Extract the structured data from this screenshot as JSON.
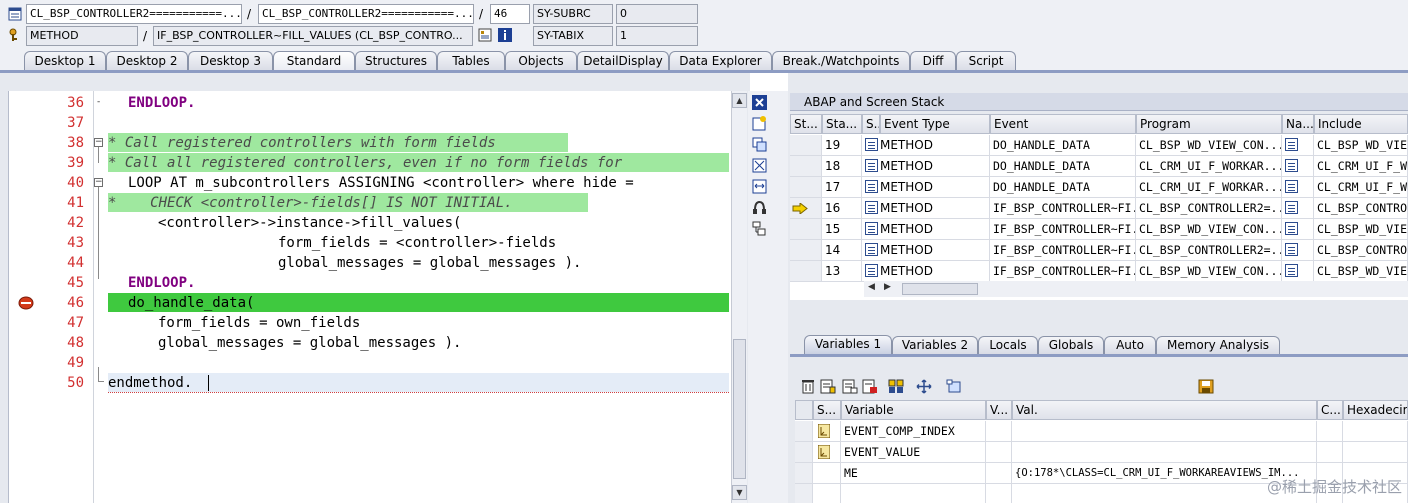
{
  "top_fields": {
    "row1": {
      "field1": "CL_BSP_CONTROLLER2===========...",
      "sep1": "/",
      "field2": "CL_BSP_CONTROLLER2===========...",
      "sep2": "/",
      "line": "46",
      "sysvar_name": "SY-SUBRC",
      "sysvar_value": "0"
    },
    "row2": {
      "field1": "METHOD",
      "sep1": "/",
      "field2": "IF_BSP_CONTROLLER~FILL_VALUES (CL_BSP_CONTRO...",
      "sysvar_name": "SY-TABIX",
      "sysvar_value": "1"
    }
  },
  "tabs": [
    "Desktop 1",
    "Desktop 2",
    "Desktop 3",
    "Standard",
    "Structures",
    "Tables",
    "Objects",
    "DetailDisplay",
    "Data Explorer",
    "Break./Watchpoints",
    "Diff",
    "Script"
  ],
  "active_tab": "Standard",
  "editor": {
    "lines": [
      {
        "no": "36",
        "text": "ENDLOOP."
      },
      {
        "no": "37",
        "text": ""
      },
      {
        "no": "38",
        "text": "* Call registered controllers with form fields"
      },
      {
        "no": "39",
        "text": "* Call all registered controllers, even if no form fields for"
      },
      {
        "no": "40",
        "text": "LOOP AT m_subcontrollers ASSIGNING <controller> where hide ="
      },
      {
        "no": "41",
        "text": "*    CHECK <controller>-fields[] IS NOT INITIAL."
      },
      {
        "no": "42",
        "text": "<controller>->instance->fill_values("
      },
      {
        "no": "43",
        "text": "form_fields = <controller>-fields"
      },
      {
        "no": "44",
        "text": "global_messages = global_messages )."
      },
      {
        "no": "45",
        "text": "ENDLOOP."
      },
      {
        "no": "46",
        "text": "do_handle_data("
      },
      {
        "no": "47",
        "text": "form_fields = own_fields"
      },
      {
        "no": "48",
        "text": "global_messages = global_messages )."
      },
      {
        "no": "49",
        "text": ""
      },
      {
        "no": "50",
        "text": "endmethod."
      }
    ]
  },
  "stack": {
    "title": "ABAP and Screen Stack",
    "headers": [
      "St...",
      "Sta...",
      "S...",
      "Event Type",
      "Event",
      "Program",
      "Na...",
      "Include"
    ],
    "rows": [
      {
        "level": "19",
        "type": "METHOD",
        "event": "DO_HANDLE_DATA",
        "program": "CL_BSP_WD_VIEW_CON...",
        "include": "CL_BSP_WD_VIE",
        "current": false
      },
      {
        "level": "18",
        "type": "METHOD",
        "event": "DO_HANDLE_DATA",
        "program": "CL_CRM_UI_F_WORKAR...",
        "include": "CL_CRM_UI_F_W",
        "current": false
      },
      {
        "level": "17",
        "type": "METHOD",
        "event": "DO_HANDLE_DATA",
        "program": "CL_CRM_UI_F_WORKAR...",
        "include": "CL_CRM_UI_F_W",
        "current": false
      },
      {
        "level": "16",
        "type": "METHOD",
        "event": "IF_BSP_CONTROLLER~FI...",
        "program": "CL_BSP_CONTROLLER2=...",
        "include": "CL_BSP_CONTRO",
        "current": true
      },
      {
        "level": "15",
        "type": "METHOD",
        "event": "IF_BSP_CONTROLLER~FI...",
        "program": "CL_BSP_WD_VIEW_CON...",
        "include": "CL_BSP_WD_VIE",
        "current": false
      },
      {
        "level": "14",
        "type": "METHOD",
        "event": "IF_BSP_CONTROLLER~FI...",
        "program": "CL_BSP_CONTROLLER2=...",
        "include": "CL_BSP_CONTRO",
        "current": false
      },
      {
        "level": "13",
        "type": "METHOD",
        "event": "IF_BSP_CONTROLLER~FI...",
        "program": "CL_BSP_WD_VIEW_CON...",
        "include": "CL_BSP_WD_VIE",
        "current": false
      }
    ]
  },
  "lower_tabs": [
    "Variables 1",
    "Variables 2",
    "Locals",
    "Globals",
    "Auto",
    "Memory Analysis"
  ],
  "active_lower_tab": "Variables 1",
  "variables": {
    "headers": [
      "S...",
      "Variable",
      "V...",
      "Val.",
      "C...",
      "Hexadecima"
    ],
    "rows": [
      {
        "name": "EVENT_COMP_INDEX",
        "value": "",
        "has_icon": true
      },
      {
        "name": "EVENT_VALUE",
        "value": "",
        "has_icon": true
      },
      {
        "name": "ME",
        "value": "{O:178*\\CLASS=CL_CRM_UI_F_WORKAREAVIEWS_IM...",
        "has_icon": false
      },
      {
        "name": "",
        "value": "",
        "has_icon": false
      }
    ]
  },
  "watermark": "@稀土掘金技术社区"
}
